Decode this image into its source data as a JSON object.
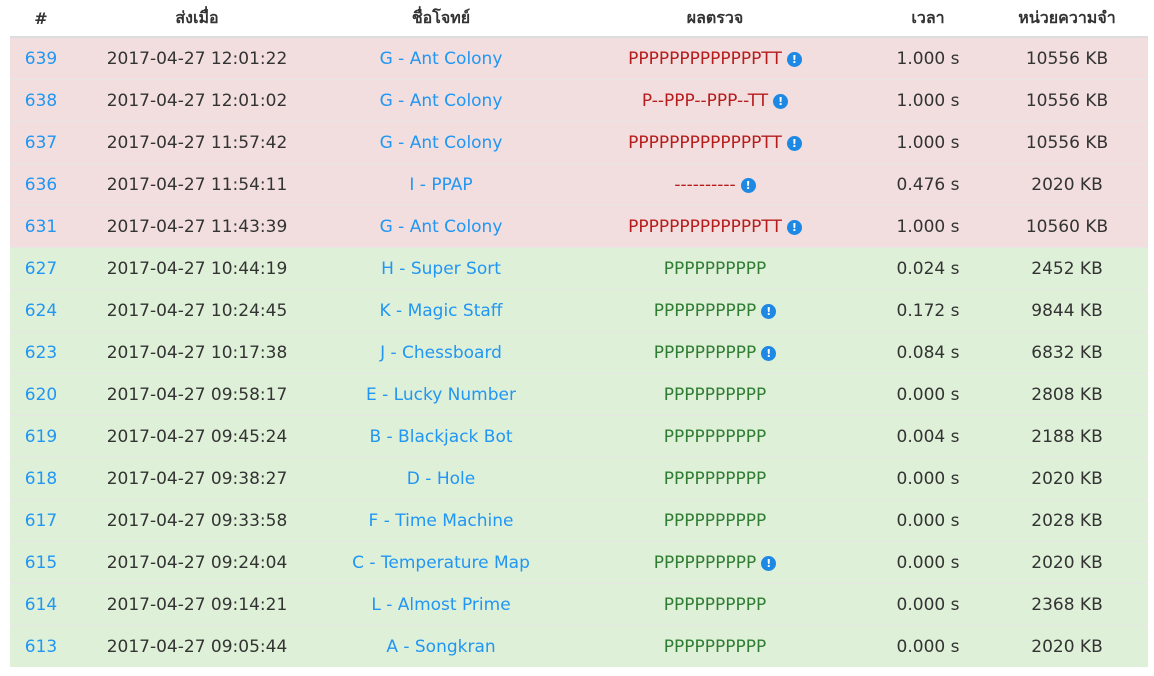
{
  "headers": {
    "id": "#",
    "submitted": "ส่งเมื่อ",
    "problem": "ชื่อโจทย์",
    "result": "ผลตรวจ",
    "time": "เวลา",
    "memory": "หน่วยความจำ"
  },
  "colors": {
    "fail_row": "#f2dede",
    "pass_row": "#dff0d8",
    "link": "#2196f3",
    "fail_text": "#b71c1c",
    "pass_text": "#2e7d32",
    "info_icon": "#1e88e5"
  },
  "rows": [
    {
      "id": "639",
      "submitted": "2017-04-27 12:01:22",
      "problem": "G - Ant Colony",
      "result": "PPPPPPPPPPPPPTT",
      "time": "1.000 s",
      "memory": "10556 KB",
      "status": "fail",
      "info": true
    },
    {
      "id": "638",
      "submitted": "2017-04-27 12:01:02",
      "problem": "G - Ant Colony",
      "result": "P--PPP--PPP--TT",
      "time": "1.000 s",
      "memory": "10556 KB",
      "status": "fail",
      "info": true
    },
    {
      "id": "637",
      "submitted": "2017-04-27 11:57:42",
      "problem": "G - Ant Colony",
      "result": "PPPPPPPPPPPPPTT",
      "time": "1.000 s",
      "memory": "10556 KB",
      "status": "fail",
      "info": true
    },
    {
      "id": "636",
      "submitted": "2017-04-27 11:54:11",
      "problem": "I - PPAP",
      "result": "----------",
      "time": "0.476 s",
      "memory": "2020 KB",
      "status": "fail",
      "info": true
    },
    {
      "id": "631",
      "submitted": "2017-04-27 11:43:39",
      "problem": "G - Ant Colony",
      "result": "PPPPPPPPPPPPPTT",
      "time": "1.000 s",
      "memory": "10560 KB",
      "status": "fail",
      "info": true
    },
    {
      "id": "627",
      "submitted": "2017-04-27 10:44:19",
      "problem": "H - Super Sort",
      "result": "PPPPPPPPPP",
      "time": "0.024 s",
      "memory": "2452 KB",
      "status": "pass",
      "info": false
    },
    {
      "id": "624",
      "submitted": "2017-04-27 10:24:45",
      "problem": "K - Magic Staff",
      "result": "PPPPPPPPPP",
      "time": "0.172 s",
      "memory": "9844 KB",
      "status": "pass",
      "info": true
    },
    {
      "id": "623",
      "submitted": "2017-04-27 10:17:38",
      "problem": "J - Chessboard",
      "result": "PPPPPPPPPP",
      "time": "0.084 s",
      "memory": "6832 KB",
      "status": "pass",
      "info": true
    },
    {
      "id": "620",
      "submitted": "2017-04-27 09:58:17",
      "problem": "E - Lucky Number",
      "result": "PPPPPPPPPP",
      "time": "0.000 s",
      "memory": "2808 KB",
      "status": "pass",
      "info": false
    },
    {
      "id": "619",
      "submitted": "2017-04-27 09:45:24",
      "problem": "B - Blackjack Bot",
      "result": "PPPPPPPPPP",
      "time": "0.004 s",
      "memory": "2188 KB",
      "status": "pass",
      "info": false
    },
    {
      "id": "618",
      "submitted": "2017-04-27 09:38:27",
      "problem": "D - Hole",
      "result": "PPPPPPPPPP",
      "time": "0.000 s",
      "memory": "2020 KB",
      "status": "pass",
      "info": false
    },
    {
      "id": "617",
      "submitted": "2017-04-27 09:33:58",
      "problem": "F - Time Machine",
      "result": "PPPPPPPPPP",
      "time": "0.000 s",
      "memory": "2028 KB",
      "status": "pass",
      "info": false
    },
    {
      "id": "615",
      "submitted": "2017-04-27 09:24:04",
      "problem": "C - Temperature Map",
      "result": "PPPPPPPPPP",
      "time": "0.000 s",
      "memory": "2020 KB",
      "status": "pass",
      "info": true
    },
    {
      "id": "614",
      "submitted": "2017-04-27 09:14:21",
      "problem": "L - Almost Prime",
      "result": "PPPPPPPPPP",
      "time": "0.000 s",
      "memory": "2368 KB",
      "status": "pass",
      "info": false
    },
    {
      "id": "613",
      "submitted": "2017-04-27 09:05:44",
      "problem": "A - Songkran",
      "result": "PPPPPPPPPP",
      "time": "0.000 s",
      "memory": "2020 KB",
      "status": "pass",
      "info": false
    }
  ]
}
